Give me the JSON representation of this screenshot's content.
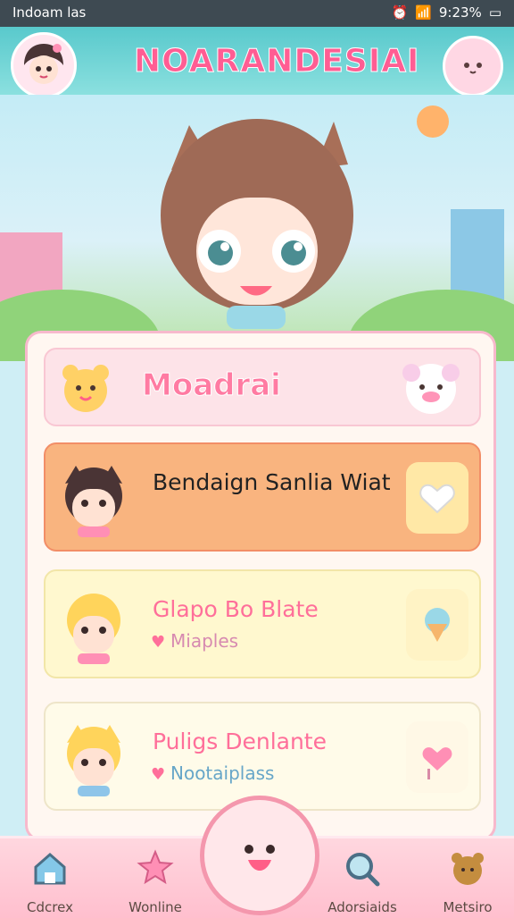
{
  "status_bar": {
    "carrier": "Indoam las",
    "battery": "9:23%"
  },
  "header": {
    "title": "NOARANDESIAI"
  },
  "banner": {
    "label": "Moadrai"
  },
  "cards": [
    {
      "title": "Bendaign Sanlia Wiat",
      "subtitle": "",
      "bg": "#f9b47f",
      "action": "heart-card-icon"
    },
    {
      "title": "Glapo Bo Blate",
      "subtitle": "Miaples",
      "bg": "#fff8cf",
      "action": "ice-cream-icon"
    },
    {
      "title": "Puligs Denlante",
      "subtitle": "Nootaiplass",
      "bg": "#fffbe9",
      "action": "heart-lollipop-icon"
    }
  ],
  "nav": {
    "items": [
      {
        "label": "Cdcrex",
        "icon": "home-icon"
      },
      {
        "label": "Wonline",
        "icon": "star-icon"
      },
      {
        "label": "Adorsiaids",
        "icon": "search-icon"
      },
      {
        "label": "Metsiro",
        "icon": "bear-face-icon"
      }
    ]
  },
  "colors": {
    "accent": "#ff5d93",
    "header": "#59c9cc",
    "panel_border": "#f7b9cc"
  }
}
